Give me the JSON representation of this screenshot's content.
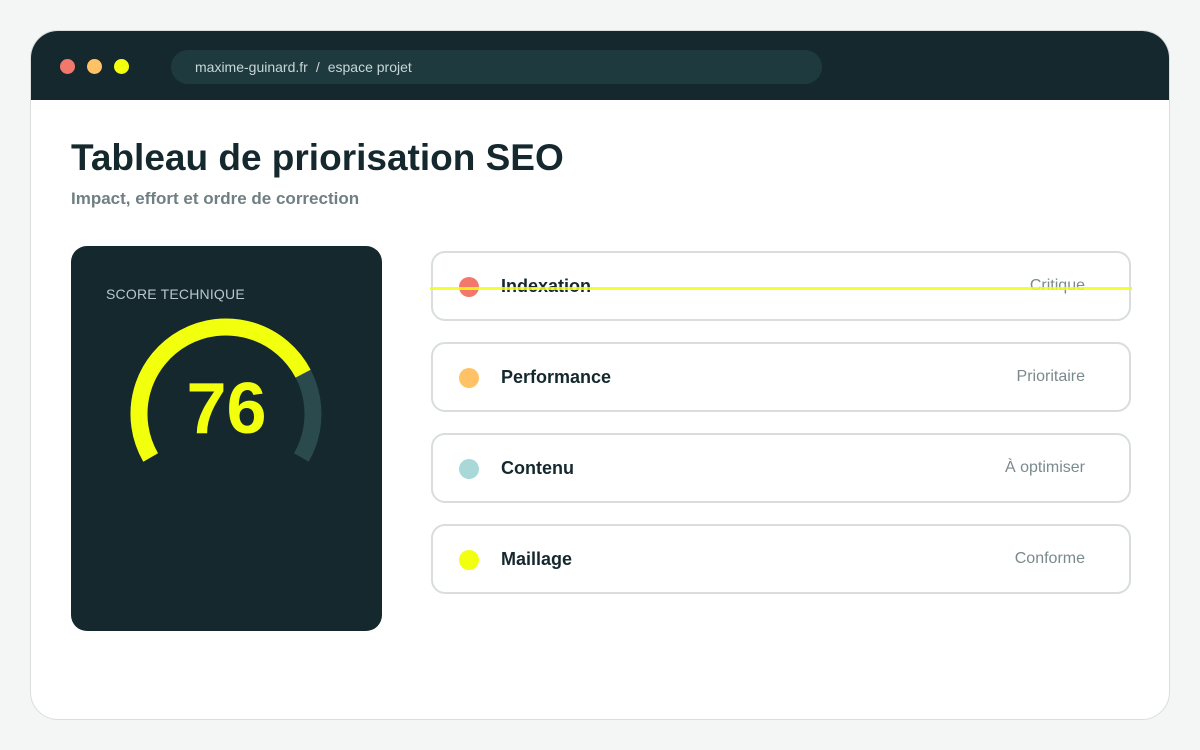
{
  "browser": {
    "url_domain": "maxime-guinard.fr",
    "url_separator": "/",
    "url_path": "espace projet"
  },
  "header": {
    "title": "Tableau de priorisation SEO",
    "subtitle": "Impact, effort et ordre de correction"
  },
  "score": {
    "label": "SCORE TECHNIQUE",
    "value": "76",
    "fraction": 0.76
  },
  "items": [
    {
      "name": "Indexation",
      "status": "Critique",
      "color": "#f2786b"
    },
    {
      "name": "Performance",
      "status": "Prioritaire",
      "color": "#ffc266"
    },
    {
      "name": "Contenu",
      "status": "À optimiser",
      "color": "#a8d8d8"
    },
    {
      "name": "Maillage",
      "status": "Conforme",
      "color": "#f2ff0d"
    }
  ],
  "colors": {
    "dark": "#14282d",
    "accent": "#f2ff0d",
    "gauge_track": "#2a4a4d",
    "dot_red": "#f2786b",
    "dot_orange": "#ffc266",
    "dot_yellow": "#f2ff0d"
  }
}
